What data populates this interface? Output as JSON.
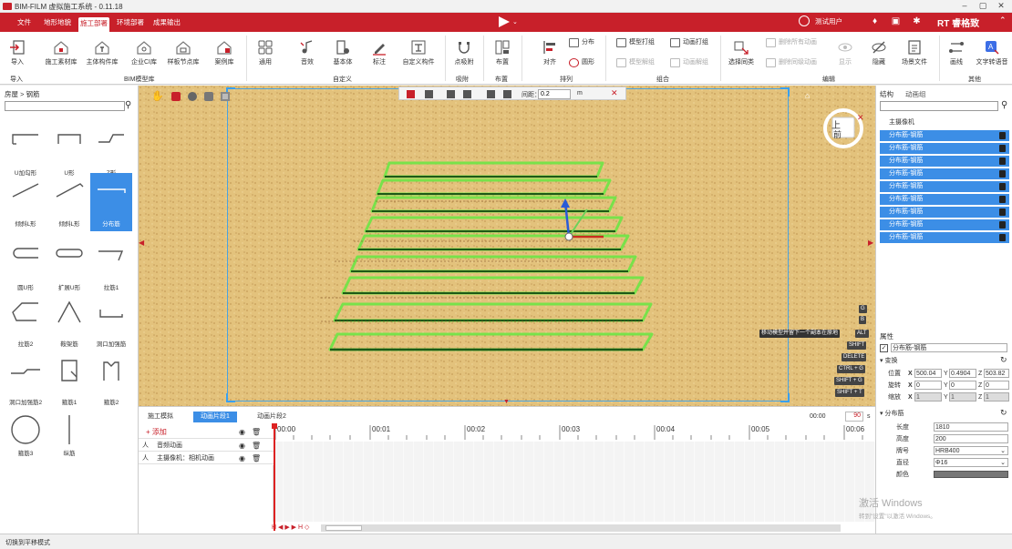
{
  "window": {
    "title": "BIM-FILM 虚拟施工系统 - 0.11.18",
    "min": "–",
    "restore": "▢",
    "close": "✕"
  },
  "menu": {
    "items": [
      "文件",
      "地形地貌",
      "施工部署",
      "环境部署",
      "成果输出"
    ],
    "active_index": 2,
    "user": "测试用户",
    "brand": "RT 睿格致"
  },
  "toolbar": {
    "model_lib": {
      "tools": [
        "导入",
        "施工素材库",
        "主体构件库",
        "企业CI库",
        "样板节点库",
        "案例库"
      ],
      "labels": {
        "import": "导入",
        "bim": "BIM模型库"
      }
    },
    "custom": {
      "tools": [
        "通用",
        "音效",
        "基本体",
        "标注",
        "自定义构件"
      ],
      "label": "自定义"
    },
    "snap": {
      "tool": "点吸附",
      "label": "吸附"
    },
    "layout": {
      "tool": "布置",
      "label": "布置"
    },
    "arrange": {
      "align": "对齐",
      "distribute": "分布",
      "shape": "圆形",
      "label": "排列"
    },
    "group": {
      "items": [
        "模型打组",
        "动画打组",
        "模型解组",
        "动画解组"
      ],
      "label": "组合"
    },
    "edit": {
      "select_same": "选择同类",
      "items": [
        "删除所有动画",
        "删除同级动画"
      ],
      "show": "显示",
      "hide": "隐藏",
      "label": "编辑"
    },
    "other": {
      "tools": [
        "场景文件",
        "画线",
        "文字转语音"
      ],
      "label": "其他"
    }
  },
  "left_panel": {
    "breadcrumb": "房屋 > 钢筋",
    "search_placeholder": "",
    "items": [
      "U加勾形",
      "U形",
      "Z形",
      "倾斜L形",
      "倾斜L形",
      "分布筋",
      "圆U形",
      "扩展U形",
      "拉筋1",
      "拉筋2",
      "鞍架筋",
      "洞口加强筋",
      "洞口加强筋2",
      "箍筋1",
      "箍筋2",
      "箍筋3",
      "纵筋"
    ],
    "selected_index": 5
  },
  "viewport": {
    "spacing_label": "间距：",
    "spacing_value": "0.2",
    "unit": "m",
    "view_top": "上",
    "view_front": "前",
    "hints": [
      "G",
      "B",
      "移动模型并留下一个副本在原地",
      "ALT",
      "SHIFT",
      "DELETE",
      "CTRL + G",
      "SHIFT + G",
      "SHIFT + T"
    ]
  },
  "right_panel": {
    "tabs": [
      "结构",
      "动画组"
    ],
    "tree_root": "主摄像机",
    "tree_items": [
      "分布筋-钢筋",
      "分布筋-钢筋",
      "分布筋-钢筋",
      "分布筋-钢筋",
      "分布筋-钢筋",
      "分布筋-钢筋",
      "分布筋-钢筋",
      "分布筋-钢筋",
      "分布筋-钢筋"
    ],
    "props_title": "属性",
    "name": "分布筋-钢筋",
    "transform": {
      "label": "变换",
      "position_label": "位置",
      "position": [
        "500.04",
        "0.4904",
        "503.82"
      ],
      "rotation_label": "旋转",
      "rotation": [
        "0",
        "0",
        "0"
      ],
      "scale_label": "缩放",
      "scale": [
        "1",
        "1",
        "1"
      ]
    },
    "rebar": {
      "label": "分布筋",
      "length_label": "长度",
      "length": "1810",
      "height_label": "高度",
      "height": "200",
      "grade_label": "牌号",
      "grade": "HRB400",
      "diameter_label": "直径",
      "diameter": "Φ16",
      "color_label": "颜色"
    }
  },
  "timeline": {
    "tabs": [
      "施工模拟",
      "动画片段1",
      "动画片段2"
    ],
    "active_tab": 1,
    "time": "00:00",
    "fps": "90",
    "fps_unit": "s",
    "add": "+ 添加",
    "tracks": [
      "音频动画",
      "主摄像机：相机动画"
    ],
    "ticks": [
      "00:00",
      "00:01",
      "00:02",
      "00:03",
      "00:04",
      "00:05",
      "00:06"
    ],
    "controls": "H ◀ ▶ ▶ H ◇"
  },
  "status": "切换到平移模式",
  "watermark": {
    "line1": "激活 Windows",
    "line2": "转到\"设置\"以激活 Windows。"
  }
}
